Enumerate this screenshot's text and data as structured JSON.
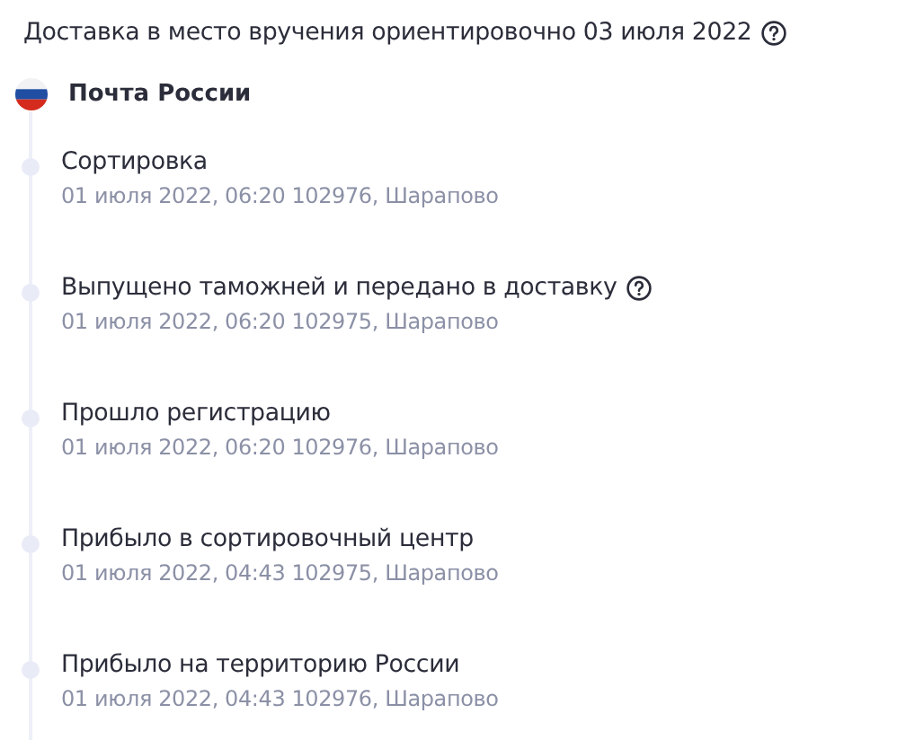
{
  "header": {
    "text": "Доставка в место вручения ориентировочно 03 июля 2022",
    "has_help": true
  },
  "carrier": {
    "name": "Почта России"
  },
  "events": [
    {
      "title": "Сортировка",
      "details": "01 июля 2022, 06:20 102976, Шарапово",
      "has_help": false
    },
    {
      "title": "Выпущено таможней и передано в доставку",
      "details": "01 июля 2022, 06:20 102975, Шарапово",
      "has_help": true
    },
    {
      "title": "Прошло регистрацию",
      "details": "01 июля 2022, 06:20 102976, Шарапово",
      "has_help": false
    },
    {
      "title": "Прибыло в сортировочный центр",
      "details": "01 июля 2022, 04:43 102975, Шарапово",
      "has_help": false
    },
    {
      "title": "Прибыло на территорию России",
      "details": "01 июля 2022, 04:43 102976, Шарапово",
      "has_help": false
    }
  ]
}
